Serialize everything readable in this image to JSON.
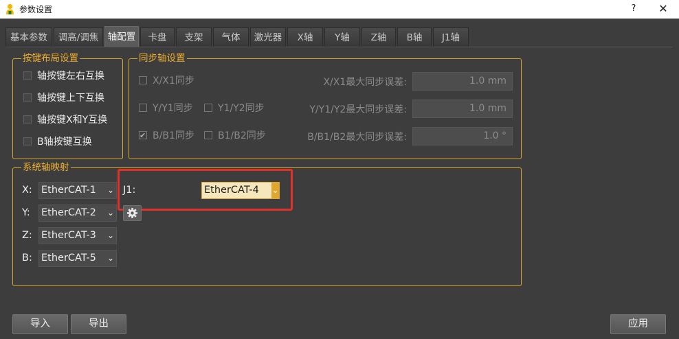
{
  "window": {
    "title": "参数设置",
    "help": "?",
    "close": "✕"
  },
  "tabs": [
    {
      "label": "基本参数"
    },
    {
      "label": "调高/调焦"
    },
    {
      "label": "轴配置"
    },
    {
      "label": "卡盘"
    },
    {
      "label": "支架"
    },
    {
      "label": "气体"
    },
    {
      "label": "激光器"
    },
    {
      "label": "X轴"
    },
    {
      "label": "Y轴"
    },
    {
      "label": "Z轴"
    },
    {
      "label": "B轴"
    },
    {
      "label": "J1轴"
    }
  ],
  "active_tab": "轴配置",
  "key_layout": {
    "title": "按键布局设置",
    "options": [
      {
        "label": "轴按键左右互换",
        "checked": false
      },
      {
        "label": "轴按键上下互换",
        "checked": false
      },
      {
        "label": "轴按键X和Y互换",
        "checked": false
      },
      {
        "label": "B轴按键互换",
        "checked": false
      }
    ]
  },
  "sync": {
    "title": "同步轴设置",
    "rows": [
      {
        "check1": "X/X1同步",
        "check1_checked": false,
        "check2": "",
        "error_label": "X/X1最大同步误差:",
        "error_value": "1.0 mm"
      },
      {
        "check1": "Y/Y1同步",
        "check1_checked": false,
        "check2": "Y1/Y2同步",
        "error_label": "Y/Y1/Y2最大同步误差:",
        "error_value": "1.0 mm"
      },
      {
        "check1": "B/B1同步",
        "check1_checked": true,
        "check2": "B1/B2同步",
        "error_label": "B/B1/B2最大同步误差:",
        "error_value": "1.0 °"
      }
    ]
  },
  "mapping": {
    "title": "系统轴映射",
    "axes": [
      {
        "label": "X:",
        "value": "EtherCAT-1"
      },
      {
        "label": "Y:",
        "value": "EtherCAT-2"
      },
      {
        "label": "Z:",
        "value": "EtherCAT-3"
      },
      {
        "label": "B:",
        "value": "EtherCAT-5"
      }
    ],
    "j1": {
      "label": "J1:",
      "value": "EtherCAT-4"
    }
  },
  "footer": {
    "import": "导入",
    "export": "导出",
    "apply": "应用"
  },
  "colors": {
    "accent": "#f0b030",
    "highlight_border": "#e0312b",
    "background": "#3d3d3d"
  }
}
